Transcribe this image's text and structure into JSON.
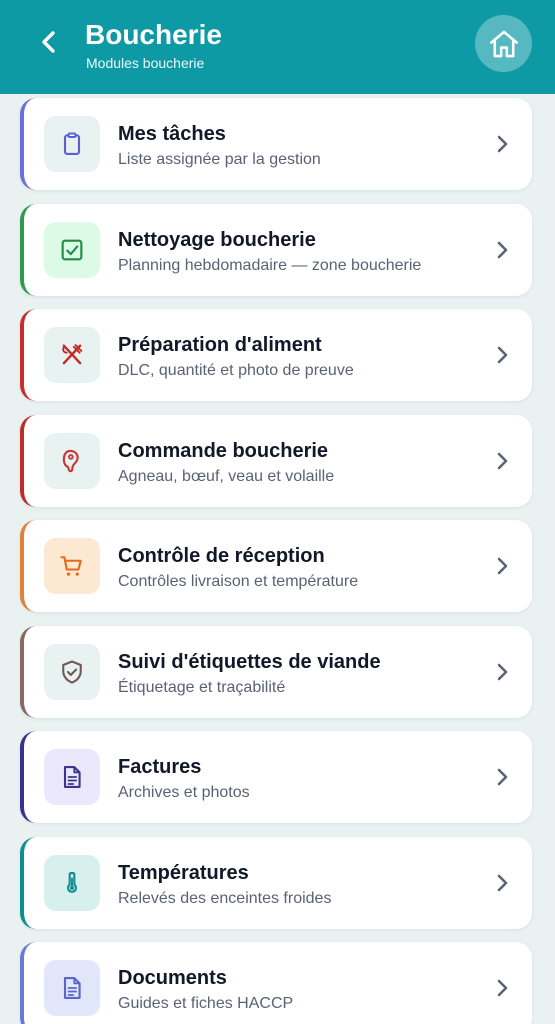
{
  "header": {
    "title": "Boucherie",
    "subtitle": "Modules boucherie",
    "back_icon": "chevron-left-icon",
    "home_icon": "home-icon"
  },
  "colors": {
    "header_bg": "#0e9aa5",
    "page_bg": "#e9f1f1",
    "chevron": "#5b6475"
  },
  "modules": [
    {
      "title": "Mes tâches",
      "subtitle": "Liste assignée par la gestion",
      "icon": "clipboard-icon",
      "accent": "#6b6fe0",
      "icon_color": "#5b5fd6",
      "icon_bg": "#e8f2f1"
    },
    {
      "title": "Nettoyage boucherie",
      "subtitle": "Planning hebdomadaire — zone boucherie",
      "icon": "checkbox-icon",
      "accent": "#2f9a4f",
      "icon_color": "#1f8a43",
      "icon_bg": "#dcfae5"
    },
    {
      "title": "Préparation d'aliment",
      "subtitle": "DLC, quantité et photo de preuve",
      "icon": "utensils-icon",
      "accent": "#cc2b2b",
      "icon_color": "#c42727",
      "icon_bg": "#e8f2f1"
    },
    {
      "title": "Commande boucherie",
      "subtitle": "Agneau, bœuf, veau et volaille",
      "icon": "meat-icon",
      "accent": "#c02a2a",
      "icon_color": "#cf3434",
      "icon_bg": "#e8f2f1"
    },
    {
      "title": "Contrôle de réception",
      "subtitle": "Contrôles livraison et température",
      "icon": "cart-icon",
      "accent": "#e3803a",
      "icon_color": "#e26a1c",
      "icon_bg": "#fde8d1"
    },
    {
      "title": "Suivi d'étiquettes de viande",
      "subtitle": "Étiquetage et traçabilité",
      "icon": "shield-check-icon",
      "accent": "#8a6a60",
      "icon_color": "#6e5a52",
      "icon_bg": "#e8f2f1"
    },
    {
      "title": "Factures",
      "subtitle": "Archives et photos",
      "icon": "invoice-icon",
      "accent": "#3b2f8f",
      "icon_color": "#3b3590",
      "icon_bg": "#ece8fb"
    },
    {
      "title": "Températures",
      "subtitle": "Relevés des enceintes froides",
      "icon": "thermometer-icon",
      "accent": "#0e8f8f",
      "icon_color": "#0f8c8c",
      "icon_bg": "#d7f0ee"
    },
    {
      "title": "Documents",
      "subtitle": "Guides et fiches HACCP",
      "icon": "document-icon",
      "accent": "#6c78d8",
      "icon_color": "#5865c9",
      "icon_bg": "#e2e6fb"
    }
  ]
}
